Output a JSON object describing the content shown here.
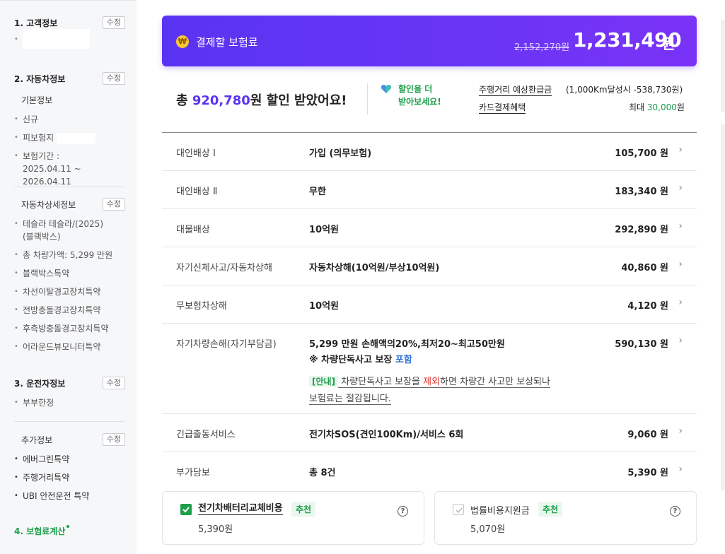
{
  "sidebar": {
    "customer": {
      "title": "1. 고객정보",
      "edit": "수정",
      "items": [
        ""
      ]
    },
    "car": {
      "title": "2. 자동차정보",
      "edit": "수정",
      "basic_title": "기본정보",
      "basic_items": [
        "신규",
        "피보험지",
        "보험기간 :",
        "2025.04.11 ~ 2026.04.11"
      ],
      "detail_title": "자동차상세정보",
      "detail_edit": "수정",
      "detail_items": [
        "테슬라 테슬라/(2025)",
        "(블랙박스)",
        "총 차량가액: 5,299 만원",
        "블랙박스특약",
        "차선이탈경고장치특약",
        "전방충돌경고장치특약",
        "후측방충돌경고장치특약",
        "어라운드뷰모니터특약"
      ]
    },
    "driver": {
      "title": "3. 운전자정보",
      "edit": "수정",
      "items": [
        "부부한정"
      ]
    },
    "extra": {
      "title": "추가정보",
      "edit": "수정",
      "items": [
        "에버그린특약",
        "주행거리특약",
        "UBI 안전운전 특약"
      ]
    },
    "calc": {
      "title": "4. 보험료계산"
    }
  },
  "banner": {
    "coin": "₩",
    "label": "결제할 보험료",
    "original_price": "2,152,270원",
    "final_price": "1,231,490",
    "final_unit": "원"
  },
  "discount": {
    "prefix": "총 ",
    "amount": "920,780",
    "suffix": "원 할인 받았어요!",
    "chevron": "›",
    "more_line1": "할인을 더",
    "more_line2": "받아보세요!",
    "mileage_label": "주행거리 예상환급금",
    "mileage_value": "(1,000Km달성시 -538,730원)",
    "card_label": "카드결제혜택",
    "card_prefix": "최대 ",
    "card_amount": "30,000",
    "card_suffix": "원"
  },
  "coverages": [
    {
      "name": "대인배상 Ⅰ",
      "detail": "가입 (의무보험)",
      "price": "105,700 원"
    },
    {
      "name": "대인배상 Ⅱ",
      "detail": "무한",
      "price": "183,340 원"
    },
    {
      "name": "대물배상",
      "detail": "10억원",
      "price": "292,890 원"
    },
    {
      "name": "자기신체사고/자동차상해",
      "detail": "자동차상해(10억원/부상10억원)",
      "price": "40,860 원"
    },
    {
      "name": "무보험차상해",
      "detail": "10억원",
      "price": "4,120 원"
    },
    {
      "name": "자기차량손해(자기부담금)",
      "detail": "5,299 만원 손해액의20%,최저20~최고50만원",
      "price": "590,130 원",
      "note_prefix": "※ 차량단독사고 보장 ",
      "note_link": "포함",
      "info_tag": "[안내]",
      "info_1": " 차량단독사고 보장을 ",
      "info_red": "제외",
      "info_2": "하면 차량간 사고만 보상되나",
      "info_3": "보험료는 절감됩니다."
    },
    {
      "name": "긴급출동서비스",
      "detail": "전기차SOS(견인100Km)/서비스 6회",
      "price": "9,060 원"
    },
    {
      "name": "부가담보",
      "detail": "총 8건",
      "price": "5,390 원"
    }
  ],
  "cards": [
    {
      "title": "전기차배터리교체비용",
      "badge": "추천",
      "price": "5,390원",
      "checked": true
    },
    {
      "title": "법률비용지원금",
      "badge": "추천",
      "price": "5,070원",
      "checked": false
    }
  ],
  "icons": {
    "chevron": "›",
    "help": "?"
  },
  "colors": {
    "primary": "#5a33f2",
    "green": "#1e9e4b",
    "red": "#e0322b",
    "link": "#2f6fd6"
  }
}
